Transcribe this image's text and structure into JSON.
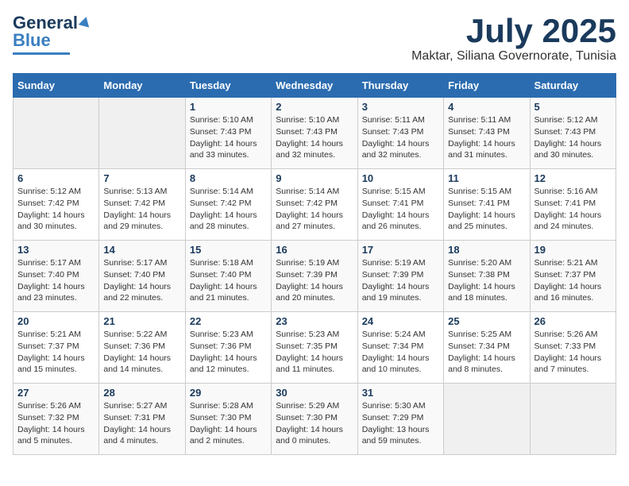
{
  "header": {
    "logo_general": "General",
    "logo_blue": "Blue",
    "month": "July 2025",
    "location": "Maktar, Siliana Governorate, Tunisia"
  },
  "weekdays": [
    "Sunday",
    "Monday",
    "Tuesday",
    "Wednesday",
    "Thursday",
    "Friday",
    "Saturday"
  ],
  "weeks": [
    [
      {
        "day": "",
        "sunrise": "",
        "sunset": "",
        "daylight": ""
      },
      {
        "day": "",
        "sunrise": "",
        "sunset": "",
        "daylight": ""
      },
      {
        "day": "1",
        "sunrise": "Sunrise: 5:10 AM",
        "sunset": "Sunset: 7:43 PM",
        "daylight": "Daylight: 14 hours and 33 minutes."
      },
      {
        "day": "2",
        "sunrise": "Sunrise: 5:10 AM",
        "sunset": "Sunset: 7:43 PM",
        "daylight": "Daylight: 14 hours and 32 minutes."
      },
      {
        "day": "3",
        "sunrise": "Sunrise: 5:11 AM",
        "sunset": "Sunset: 7:43 PM",
        "daylight": "Daylight: 14 hours and 32 minutes."
      },
      {
        "day": "4",
        "sunrise": "Sunrise: 5:11 AM",
        "sunset": "Sunset: 7:43 PM",
        "daylight": "Daylight: 14 hours and 31 minutes."
      },
      {
        "day": "5",
        "sunrise": "Sunrise: 5:12 AM",
        "sunset": "Sunset: 7:43 PM",
        "daylight": "Daylight: 14 hours and 30 minutes."
      }
    ],
    [
      {
        "day": "6",
        "sunrise": "Sunrise: 5:12 AM",
        "sunset": "Sunset: 7:42 PM",
        "daylight": "Daylight: 14 hours and 30 minutes."
      },
      {
        "day": "7",
        "sunrise": "Sunrise: 5:13 AM",
        "sunset": "Sunset: 7:42 PM",
        "daylight": "Daylight: 14 hours and 29 minutes."
      },
      {
        "day": "8",
        "sunrise": "Sunrise: 5:14 AM",
        "sunset": "Sunset: 7:42 PM",
        "daylight": "Daylight: 14 hours and 28 minutes."
      },
      {
        "day": "9",
        "sunrise": "Sunrise: 5:14 AM",
        "sunset": "Sunset: 7:42 PM",
        "daylight": "Daylight: 14 hours and 27 minutes."
      },
      {
        "day": "10",
        "sunrise": "Sunrise: 5:15 AM",
        "sunset": "Sunset: 7:41 PM",
        "daylight": "Daylight: 14 hours and 26 minutes."
      },
      {
        "day": "11",
        "sunrise": "Sunrise: 5:15 AM",
        "sunset": "Sunset: 7:41 PM",
        "daylight": "Daylight: 14 hours and 25 minutes."
      },
      {
        "day": "12",
        "sunrise": "Sunrise: 5:16 AM",
        "sunset": "Sunset: 7:41 PM",
        "daylight": "Daylight: 14 hours and 24 minutes."
      }
    ],
    [
      {
        "day": "13",
        "sunrise": "Sunrise: 5:17 AM",
        "sunset": "Sunset: 7:40 PM",
        "daylight": "Daylight: 14 hours and 23 minutes."
      },
      {
        "day": "14",
        "sunrise": "Sunrise: 5:17 AM",
        "sunset": "Sunset: 7:40 PM",
        "daylight": "Daylight: 14 hours and 22 minutes."
      },
      {
        "day": "15",
        "sunrise": "Sunrise: 5:18 AM",
        "sunset": "Sunset: 7:40 PM",
        "daylight": "Daylight: 14 hours and 21 minutes."
      },
      {
        "day": "16",
        "sunrise": "Sunrise: 5:19 AM",
        "sunset": "Sunset: 7:39 PM",
        "daylight": "Daylight: 14 hours and 20 minutes."
      },
      {
        "day": "17",
        "sunrise": "Sunrise: 5:19 AM",
        "sunset": "Sunset: 7:39 PM",
        "daylight": "Daylight: 14 hours and 19 minutes."
      },
      {
        "day": "18",
        "sunrise": "Sunrise: 5:20 AM",
        "sunset": "Sunset: 7:38 PM",
        "daylight": "Daylight: 14 hours and 18 minutes."
      },
      {
        "day": "19",
        "sunrise": "Sunrise: 5:21 AM",
        "sunset": "Sunset: 7:37 PM",
        "daylight": "Daylight: 14 hours and 16 minutes."
      }
    ],
    [
      {
        "day": "20",
        "sunrise": "Sunrise: 5:21 AM",
        "sunset": "Sunset: 7:37 PM",
        "daylight": "Daylight: 14 hours and 15 minutes."
      },
      {
        "day": "21",
        "sunrise": "Sunrise: 5:22 AM",
        "sunset": "Sunset: 7:36 PM",
        "daylight": "Daylight: 14 hours and 14 minutes."
      },
      {
        "day": "22",
        "sunrise": "Sunrise: 5:23 AM",
        "sunset": "Sunset: 7:36 PM",
        "daylight": "Daylight: 14 hours and 12 minutes."
      },
      {
        "day": "23",
        "sunrise": "Sunrise: 5:23 AM",
        "sunset": "Sunset: 7:35 PM",
        "daylight": "Daylight: 14 hours and 11 minutes."
      },
      {
        "day": "24",
        "sunrise": "Sunrise: 5:24 AM",
        "sunset": "Sunset: 7:34 PM",
        "daylight": "Daylight: 14 hours and 10 minutes."
      },
      {
        "day": "25",
        "sunrise": "Sunrise: 5:25 AM",
        "sunset": "Sunset: 7:34 PM",
        "daylight": "Daylight: 14 hours and 8 minutes."
      },
      {
        "day": "26",
        "sunrise": "Sunrise: 5:26 AM",
        "sunset": "Sunset: 7:33 PM",
        "daylight": "Daylight: 14 hours and 7 minutes."
      }
    ],
    [
      {
        "day": "27",
        "sunrise": "Sunrise: 5:26 AM",
        "sunset": "Sunset: 7:32 PM",
        "daylight": "Daylight: 14 hours and 5 minutes."
      },
      {
        "day": "28",
        "sunrise": "Sunrise: 5:27 AM",
        "sunset": "Sunset: 7:31 PM",
        "daylight": "Daylight: 14 hours and 4 minutes."
      },
      {
        "day": "29",
        "sunrise": "Sunrise: 5:28 AM",
        "sunset": "Sunset: 7:30 PM",
        "daylight": "Daylight: 14 hours and 2 minutes."
      },
      {
        "day": "30",
        "sunrise": "Sunrise: 5:29 AM",
        "sunset": "Sunset: 7:30 PM",
        "daylight": "Daylight: 14 hours and 0 minutes."
      },
      {
        "day": "31",
        "sunrise": "Sunrise: 5:30 AM",
        "sunset": "Sunset: 7:29 PM",
        "daylight": "Daylight: 13 hours and 59 minutes."
      },
      {
        "day": "",
        "sunrise": "",
        "sunset": "",
        "daylight": ""
      },
      {
        "day": "",
        "sunrise": "",
        "sunset": "",
        "daylight": ""
      }
    ]
  ]
}
